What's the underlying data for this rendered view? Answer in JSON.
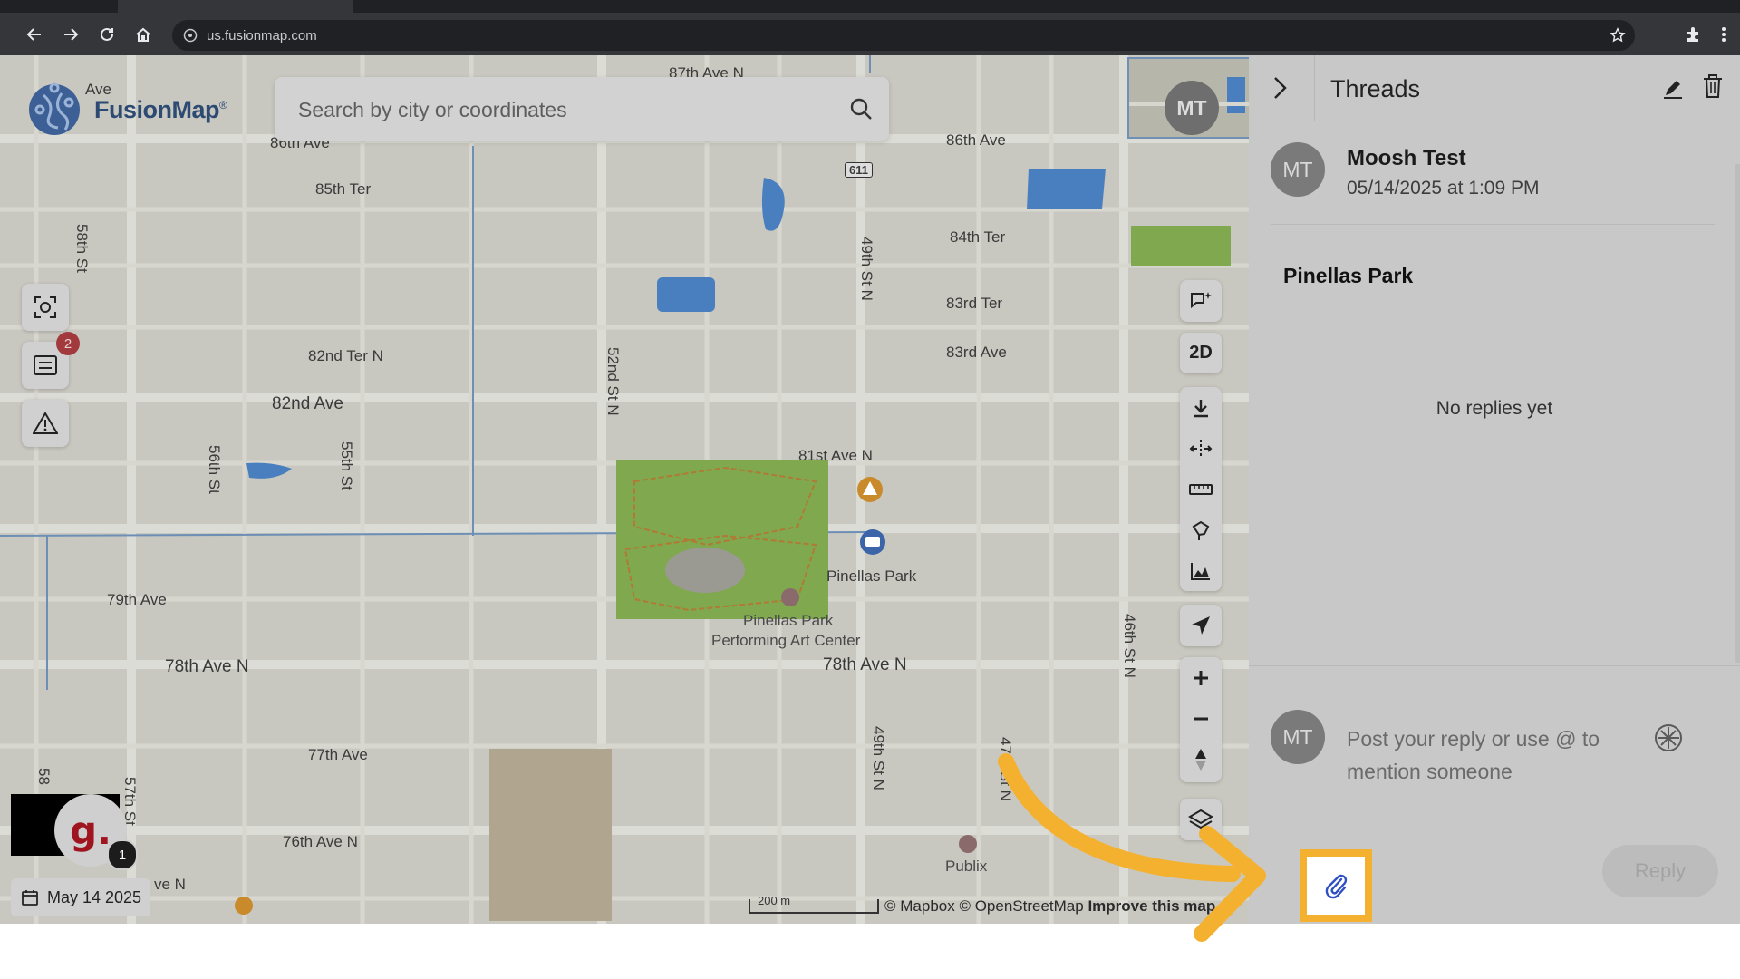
{
  "browser": {
    "url": "us.fusionmap.com",
    "icons": [
      "back-icon",
      "forward-icon",
      "reload-icon",
      "home-icon",
      "site-info-icon",
      "bookmark-star-icon",
      "extensions-icon",
      "menu-icon"
    ]
  },
  "brand": {
    "name": "FusionMap",
    "trademark": "®"
  },
  "search": {
    "placeholder": "Search by city or coordinates"
  },
  "map": {
    "labels": {
      "ave87": "87th Ave N",
      "ave86w": "86th Ave",
      "ave86e": "86th Ave",
      "ave_top": "Ave",
      "ter85": "85th Ter",
      "ter84": "84th Ter",
      "ter83": "83rd Ter",
      "ave83": "83rd Ave",
      "ter82": "82nd Ter N",
      "ave82": "82nd Ave",
      "ave81": "81st Ave N",
      "ave79": "79th Ave",
      "ave78w": "78th Ave N",
      "ave78e": "78th Ave N",
      "ave77": "77th Ave",
      "ave76": "76th Ave N",
      "ave_bottom": "ve N",
      "st58": "58th St",
      "st56": "56th St",
      "st55": "55th St",
      "st52": "52nd St N",
      "st49a": "49th St N",
      "st49b": "49th St N",
      "st46": "46th St N",
      "st47": "47th St N",
      "st58b": "58",
      "st57": "57th St",
      "hwy": "611",
      "park": "Pinellas Park",
      "pac1": "Pinellas Park",
      "pac2": "Performing Art Center",
      "publix": "Publix"
    },
    "scale": "200 m",
    "attribution_prefix": "© Mapbox © OpenStreetMap",
    "attribution_link": "Improve this map",
    "user_initials": "MT",
    "date": "May 14 2025",
    "notification_count": "2",
    "g_letter": "g.",
    "g_count": "1",
    "tools": {
      "view_mode": "2D"
    }
  },
  "panel": {
    "title": "Threads",
    "thread": {
      "initials": "MT",
      "author": "Moosh Test",
      "time": "05/14/2025 at 1:09 PM",
      "topic": "Pinellas Park"
    },
    "empty_text": "No replies yet",
    "reply": {
      "initials": "MT",
      "placeholder": "Post your reply or use @ to mention someone",
      "button": "Reply"
    }
  },
  "colors": {
    "highlight": "#f4b130",
    "arrow": "#f4b130",
    "map_bg": "#c9c8c0",
    "park_green": "#7fa84f",
    "water_blue": "#4a7fbf"
  }
}
